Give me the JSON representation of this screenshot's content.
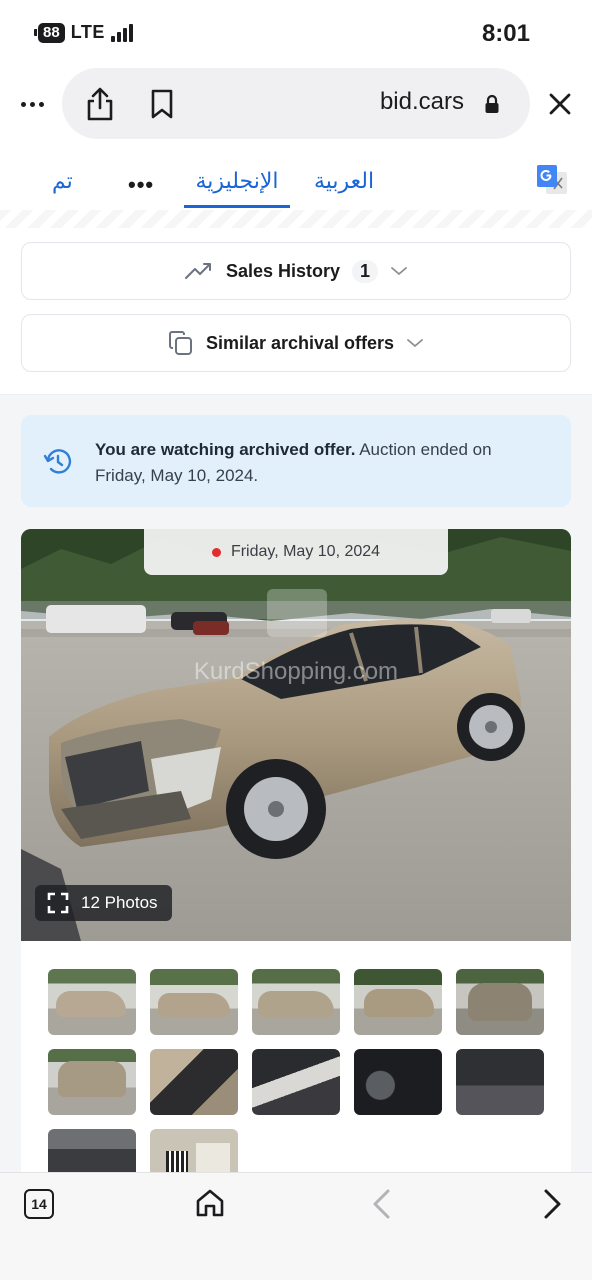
{
  "status_bar": {
    "battery": "88",
    "network": "LTE",
    "time": "8:01"
  },
  "browser": {
    "url": "bid.cars"
  },
  "translate_bar": {
    "done_label": "تم",
    "more_label": "•••",
    "english_label": "الإنجليزية",
    "arabic_label": "العربية"
  },
  "sales_history": {
    "label": "Sales History",
    "count": "1"
  },
  "similar_offers": {
    "label": "Similar archival offers"
  },
  "notice": {
    "bold": "You are watching archived offer.",
    "text": " Auction ended on Friday, May 10, 2024."
  },
  "gallery": {
    "date": "Friday, May 10, 2024",
    "photos_label": "12 Photos",
    "watermark": "KurdShopping.com"
  },
  "toolbar": {
    "tabs_count": "14"
  },
  "colors": {
    "accent": "#1a66d6",
    "notice_bg": "#e2f0fc",
    "live_dot": "#e32d2d"
  }
}
